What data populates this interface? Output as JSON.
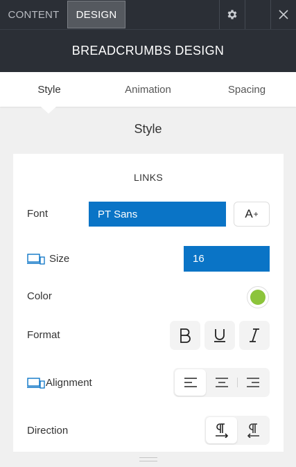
{
  "top_tabs": [
    {
      "label": "CONTENT",
      "active": false
    },
    {
      "label": "DESIGN",
      "active": true
    }
  ],
  "top_icons": [
    "gear-icon",
    "blank",
    "close-icon"
  ],
  "panel_title": "BREADCRUMBS DESIGN",
  "sub_tabs": [
    {
      "label": "Style",
      "active": true
    },
    {
      "label": "Animation",
      "active": false
    },
    {
      "label": "Spacing",
      "active": false
    }
  ],
  "section_title": "Style",
  "group": {
    "heading": "LINKS",
    "font": {
      "label": "Font",
      "value": "PT Sans",
      "size_button": "A"
    },
    "size": {
      "label": "Size",
      "value": "16"
    },
    "color": {
      "label": "Color",
      "value": "#8cc43b"
    },
    "format": {
      "label": "Format",
      "options": [
        "bold-icon",
        "underline-icon",
        "italic-icon"
      ]
    },
    "alignment": {
      "label": "Alignment",
      "options": [
        "align-left-icon",
        "align-center-icon",
        "align-right-icon"
      ],
      "selected": "align-left-icon"
    },
    "direction": {
      "label": "Direction",
      "options": [
        "ltr-icon",
        "rtl-icon"
      ],
      "selected": "ltr-icon"
    }
  },
  "colors": {
    "topbar": "#2b2f36",
    "accent": "#0a74c6"
  }
}
